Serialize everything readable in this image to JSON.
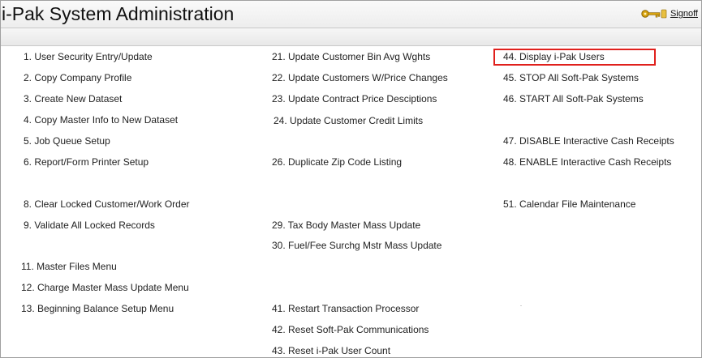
{
  "header": {
    "title": "i-Pak System Administration",
    "signoff_label": "Signoff"
  },
  "icons": {
    "signoff": "key-icon"
  },
  "colors": {
    "highlight_border": "#e0201c"
  },
  "menu": {
    "col1": [
      {
        "id": "1",
        "label": "1. User Security Entry/Update"
      },
      {
        "id": "2",
        "label": "2. Copy Company Profile"
      },
      {
        "id": "3",
        "label": "3. Create New Dataset"
      },
      {
        "id": "4",
        "label": "4. Copy Master Info to New Dataset"
      },
      {
        "id": "5",
        "label": "5. Job Queue Setup"
      },
      {
        "id": "6",
        "label": "6. Report/Form Printer Setup"
      },
      {
        "id": "8",
        "label": "8. Clear Locked Customer/Work Order"
      },
      {
        "id": "9",
        "label": "9. Validate All Locked Records"
      },
      {
        "id": "11",
        "label": "11. Master Files Menu"
      },
      {
        "id": "12",
        "label": "12. Charge Master Mass Update Menu"
      },
      {
        "id": "13",
        "label": "13. Beginning Balance Setup Menu"
      }
    ],
    "col2": [
      {
        "id": "21",
        "label": "21. Update Customer Bin Avg Wghts"
      },
      {
        "id": "22",
        "label": "22. Update Customers W/Price Changes"
      },
      {
        "id": "23",
        "label": "23. Update Contract Price Desciptions"
      },
      {
        "id": "24",
        "label": "24. Update Customer Credit Limits"
      },
      {
        "id": "26",
        "label": "26. Duplicate Zip Code Listing"
      },
      {
        "id": "29",
        "label": "29. Tax Body Master Mass Update"
      },
      {
        "id": "30",
        "label": "30. Fuel/Fee Surchg Mstr Mass Update"
      },
      {
        "id": "41",
        "label": "41. Restart Transaction Processor"
      },
      {
        "id": "42",
        "label": "42. Reset Soft-Pak Communications"
      },
      {
        "id": "43",
        "label": "43. Reset i-Pak User Count"
      }
    ],
    "col3": [
      {
        "id": "44",
        "label": "44. Display i-Pak Users"
      },
      {
        "id": "45",
        "label": "45. STOP All Soft-Pak Systems"
      },
      {
        "id": "46",
        "label": "46. START All Soft-Pak Systems"
      },
      {
        "id": "47",
        "label": "47. DISABLE Interactive Cash Receipts"
      },
      {
        "id": "48",
        "label": "48. ENABLE Interactive Cash Receipts"
      },
      {
        "id": "51",
        "label": "51. Calendar File Maintenance"
      }
    ]
  }
}
